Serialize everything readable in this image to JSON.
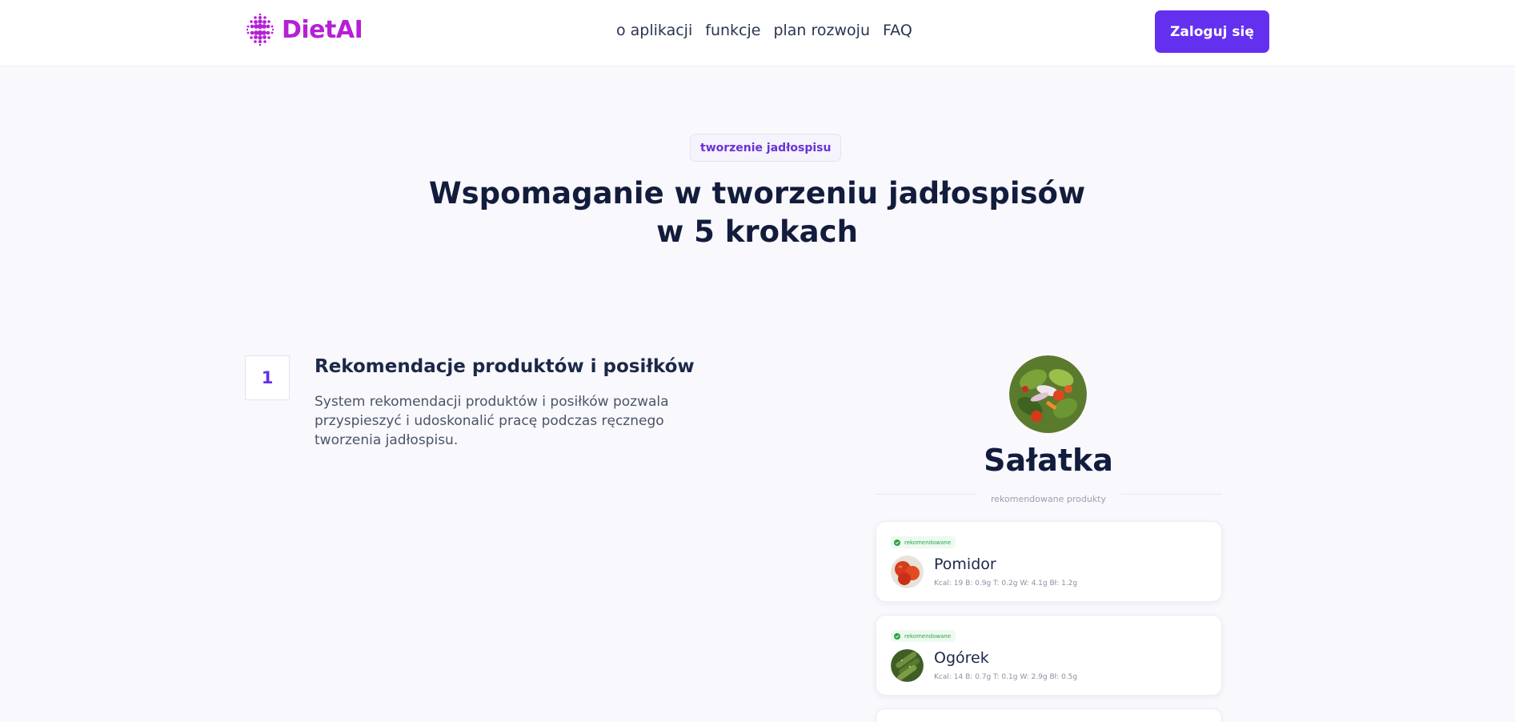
{
  "header": {
    "logo_text": "DietAI",
    "nav": [
      "o aplikacji",
      "funkcje",
      "plan rozwoju",
      "FAQ"
    ],
    "login_label": "Zaloguj się"
  },
  "section": {
    "badge": "tworzenie jadłospisu",
    "title_line1": "Wspomaganie w tworzeniu jadłospisów",
    "title_line2": "w 5 krokach"
  },
  "step": {
    "number": "1",
    "title": "Rekomendacje produktów i posiłków",
    "description": "System rekomendacji produktów i posiłków pozwala przyspieszyć i udoskonalić pracę podczas ręcznego tworzenia jadłospisu."
  },
  "dish": {
    "name": "Sałatka",
    "divider_label": "rekomendowane produkty",
    "products": [
      {
        "badge": "rekomendowane",
        "name": "Pomidor",
        "macros": "Kcal: 19   B: 0.9g   T: 0.2g   W: 4.1g   Bł: 1.2g",
        "icon": "tomato-icon"
      },
      {
        "badge": "rekomendowane",
        "name": "Ogórek",
        "macros": "Kcal: 14   B: 0.7g   T: 0.1g   W: 2.9g   Bł: 0.5g",
        "icon": "cucumber-icon"
      }
    ]
  },
  "colors": {
    "brand": "#b61fd6",
    "accent": "#6430ef",
    "recommended": "#2ca34a"
  }
}
